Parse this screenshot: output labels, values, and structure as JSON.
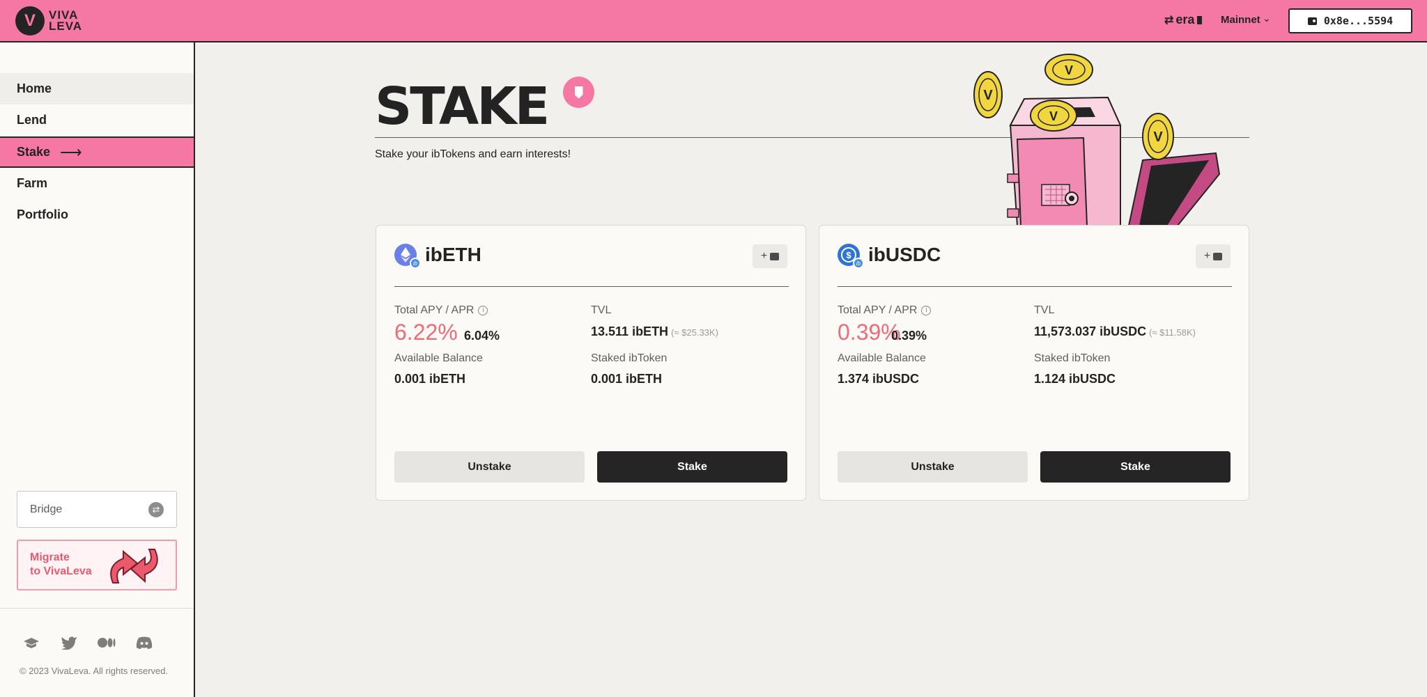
{
  "header": {
    "logo_text_1": "VIVA",
    "logo_text_2": "LEVA",
    "network_brand": "era",
    "network": "Mainnet",
    "wallet_address": "0x8e...5594"
  },
  "sidebar": {
    "items": [
      {
        "label": "Home"
      },
      {
        "label": "Lend"
      },
      {
        "label": "Stake"
      },
      {
        "label": "Farm"
      },
      {
        "label": "Portfolio"
      }
    ],
    "bridge_label": "Bridge",
    "migrate_line1": "Migrate",
    "migrate_line2": "to VivaLeva",
    "socials": [
      "docs-icon",
      "twitter-icon",
      "medium-icon",
      "discord-icon"
    ],
    "copyright": "© 2023 VivaLeva. All rights reserved."
  },
  "page": {
    "title": "STAKE",
    "subtitle": "Stake your ibTokens and earn interests!"
  },
  "labels": {
    "apy": "Total APY / APR",
    "tvl": "TVL",
    "available": "Available Balance",
    "staked": "Staked ibToken",
    "unstake": "Unstake",
    "stake": "Stake",
    "add": "+"
  },
  "cards": [
    {
      "token": "ibETH",
      "apy": "6.22%",
      "apr": "6.04%",
      "tvl": "13.511 ibETH",
      "tvl_usd": "(≈ $25.33K)",
      "available": "0.001 ibETH",
      "staked": "0.001 ibETH",
      "icon_color": "#6a7fe8"
    },
    {
      "token": "ibUSDC",
      "apy": "0.39%",
      "apr": "0.39%",
      "tvl": "11,573.037 ibUSDC",
      "tvl_usd": "(≈ $11.58K)",
      "available": "1.374 ibUSDC",
      "staked": "1.124 ibUSDC",
      "icon_color": "#2f73d6"
    }
  ],
  "colors": {
    "brand_pink": "#f577a4",
    "apy_red": "#ef6b78",
    "dark": "#252525"
  }
}
